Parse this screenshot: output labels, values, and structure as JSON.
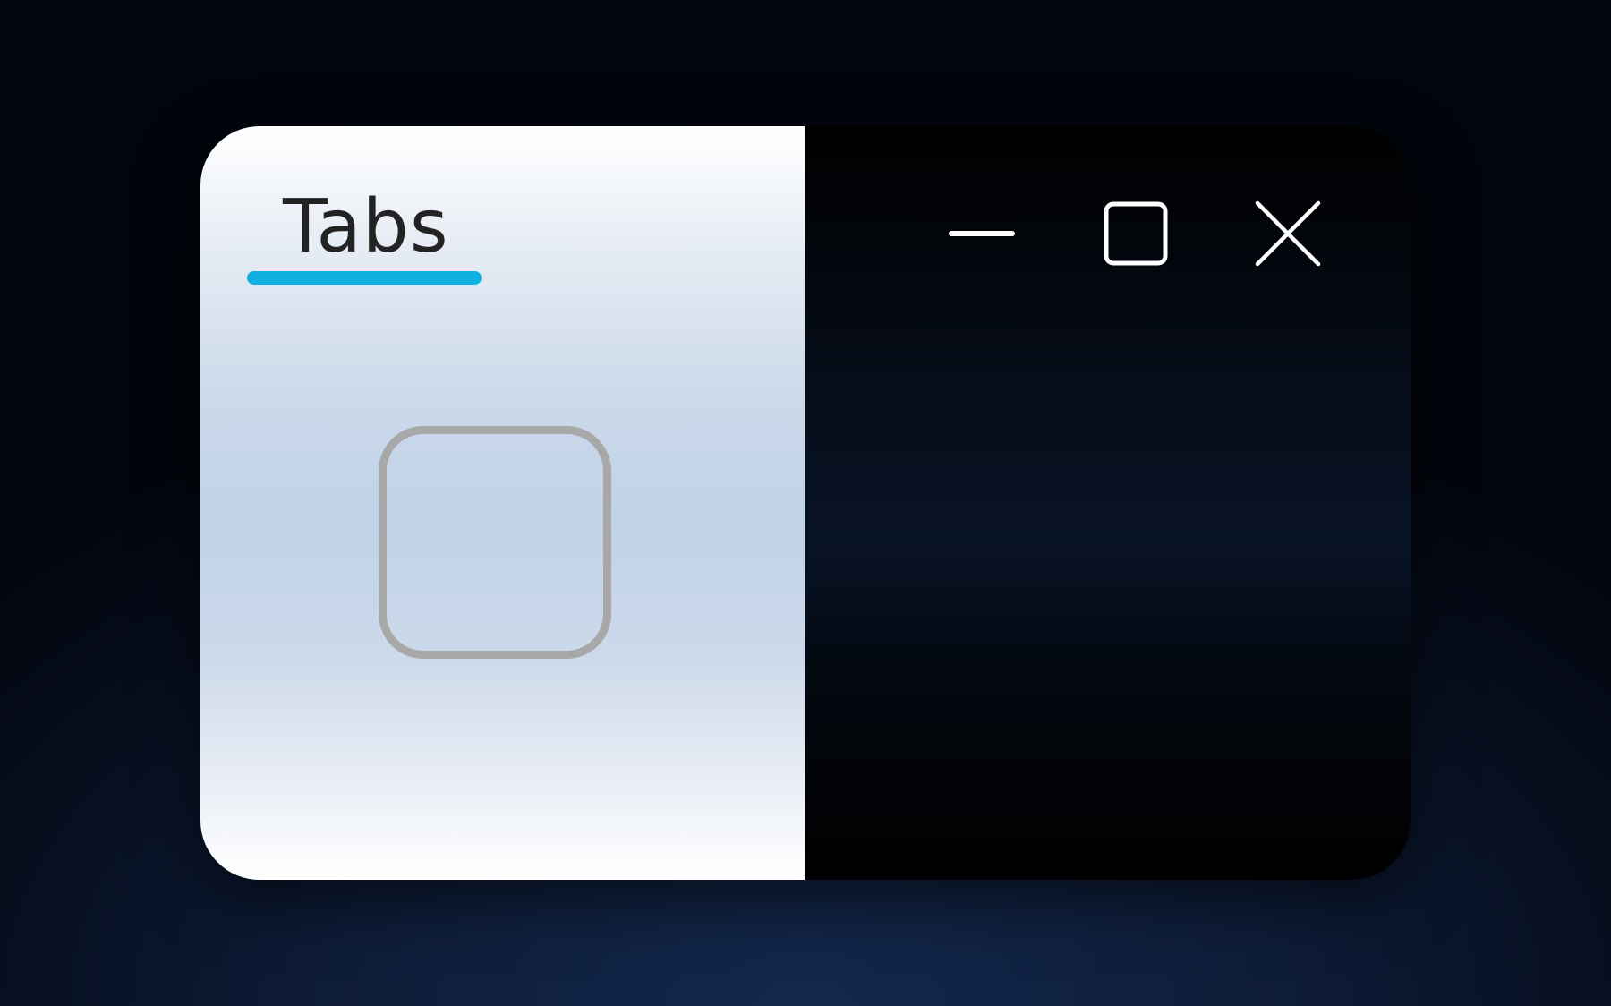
{
  "tabs": [
    {
      "label": "Tabs",
      "active": true
    }
  ],
  "window_controls": {
    "minimize_icon": "minimize-icon",
    "maximize_icon": "maximize-icon",
    "close_icon": "close-icon"
  },
  "checkboxes": {
    "light_state": "unchecked",
    "dark_state": "checked",
    "check_icon": "checkmark-icon"
  },
  "colors": {
    "accent": "#11b0e1",
    "checkbox_border_light": "#a8a8a8",
    "window_control_stroke": "#ffffff",
    "tab_text": "#232323"
  }
}
